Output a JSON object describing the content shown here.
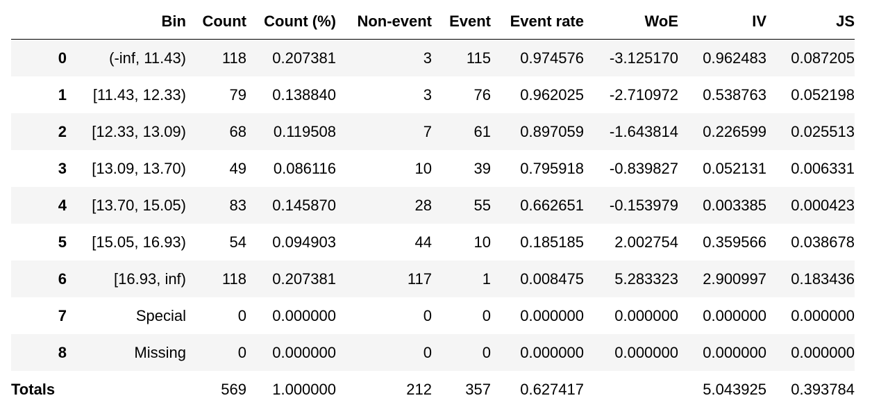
{
  "table": {
    "headers": [
      "",
      "Bin",
      "Count",
      "Count (%)",
      "Non-event",
      "Event",
      "Event rate",
      "WoE",
      "IV",
      "JS"
    ],
    "rows": [
      {
        "index": "0",
        "cells": [
          "(-inf, 11.43)",
          "118",
          "0.207381",
          "3",
          "115",
          "0.974576",
          "-3.125170",
          "0.962483",
          "0.087205"
        ]
      },
      {
        "index": "1",
        "cells": [
          "[11.43, 12.33)",
          "79",
          "0.138840",
          "3",
          "76",
          "0.962025",
          "-2.710972",
          "0.538763",
          "0.052198"
        ]
      },
      {
        "index": "2",
        "cells": [
          "[12.33, 13.09)",
          "68",
          "0.119508",
          "7",
          "61",
          "0.897059",
          "-1.643814",
          "0.226599",
          "0.025513"
        ]
      },
      {
        "index": "3",
        "cells": [
          "[13.09, 13.70)",
          "49",
          "0.086116",
          "10",
          "39",
          "0.795918",
          "-0.839827",
          "0.052131",
          "0.006331"
        ]
      },
      {
        "index": "4",
        "cells": [
          "[13.70, 15.05)",
          "83",
          "0.145870",
          "28",
          "55",
          "0.662651",
          "-0.153979",
          "0.003385",
          "0.000423"
        ]
      },
      {
        "index": "5",
        "cells": [
          "[15.05, 16.93)",
          "54",
          "0.094903",
          "44",
          "10",
          "0.185185",
          "2.002754",
          "0.359566",
          "0.038678"
        ]
      },
      {
        "index": "6",
        "cells": [
          "[16.93, inf)",
          "118",
          "0.207381",
          "117",
          "1",
          "0.008475",
          "5.283323",
          "2.900997",
          "0.183436"
        ]
      },
      {
        "index": "7",
        "cells": [
          "Special",
          "0",
          "0.000000",
          "0",
          "0",
          "0.000000",
          "0.000000",
          "0.000000",
          "0.000000"
        ]
      },
      {
        "index": "8",
        "cells": [
          "Missing",
          "0",
          "0.000000",
          "0",
          "0",
          "0.000000",
          "0.000000",
          "0.000000",
          "0.000000"
        ]
      },
      {
        "index": "Totals",
        "cells": [
          "",
          "569",
          "1.000000",
          "212",
          "357",
          "0.627417",
          "",
          "5.043925",
          "0.393784"
        ]
      }
    ]
  }
}
